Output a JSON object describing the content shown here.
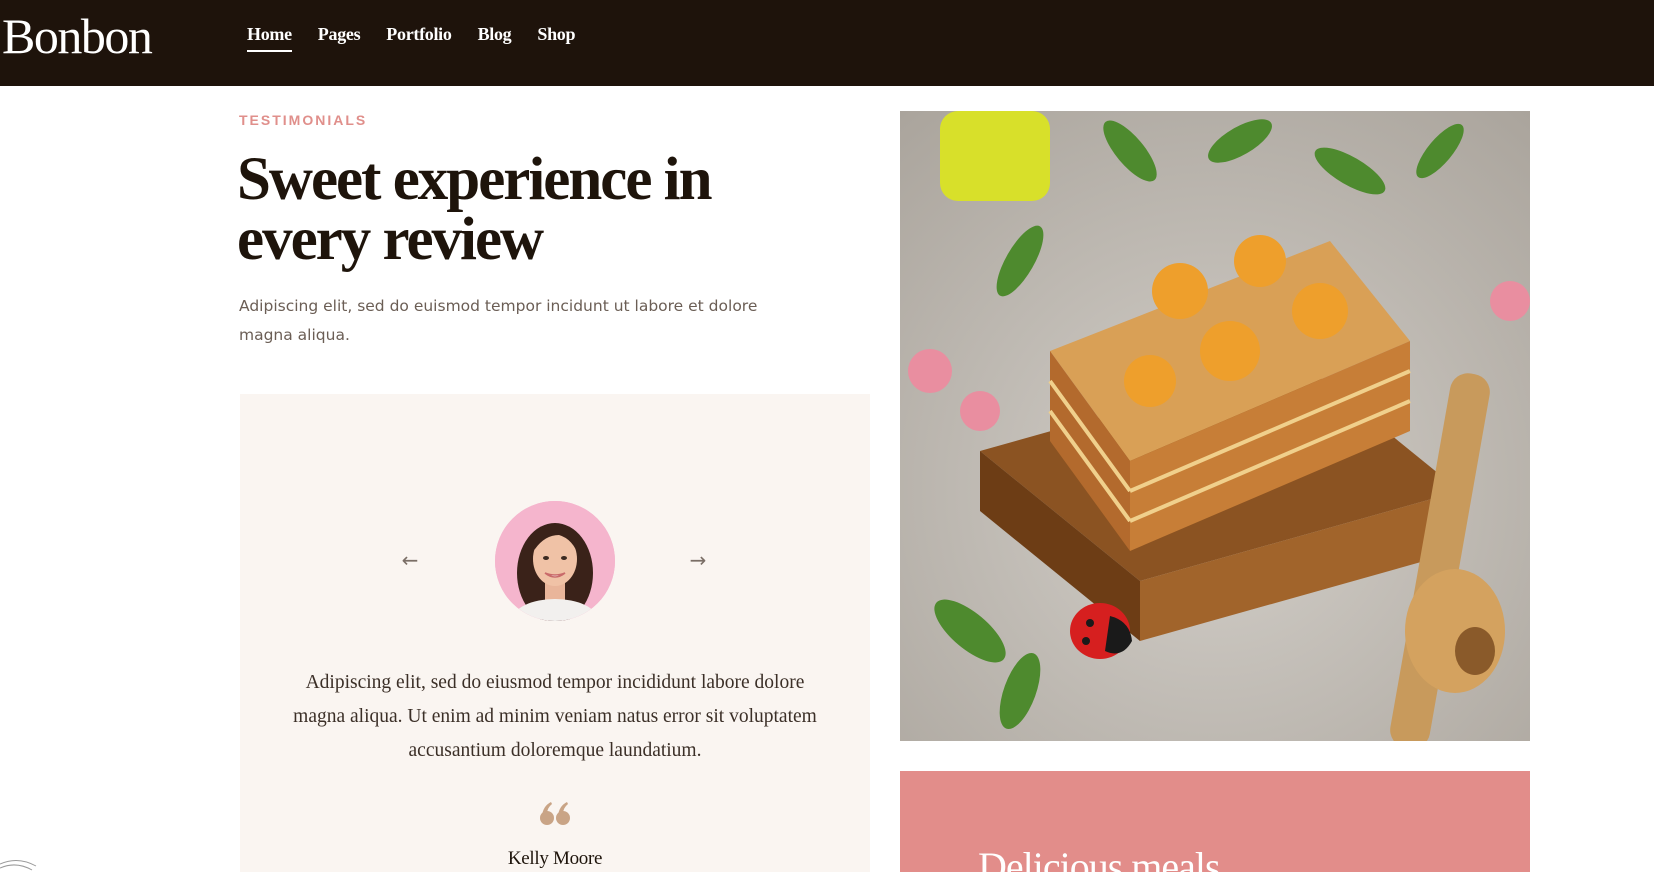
{
  "brand": {
    "logo_text": "Bonbon"
  },
  "nav": {
    "items": [
      {
        "label": "Home",
        "active": true
      },
      {
        "label": "Pages",
        "active": false
      },
      {
        "label": "Portfolio",
        "active": false
      },
      {
        "label": "Blog",
        "active": false
      },
      {
        "label": "Shop",
        "active": false
      }
    ]
  },
  "testimonials": {
    "eyebrow": "TESTIMONIALS",
    "heading_line1": "Sweet experience in",
    "heading_line2": "every review",
    "lead": "Adipiscing elit, sed do euismod tempor incidunt ut labore et dolore magna aliqua.",
    "prev_icon": "arrow-left-icon",
    "next_icon": "arrow-right-icon",
    "quote": "Adipiscing elit, sed do eiusmod tempor incididunt labore dolore magna aliqua. Ut enim ad minim veniam natus error sit voluptatem accusantium doloremque laundatium.",
    "author": "Kelly Moore"
  },
  "promo": {
    "title": "Delicious meals"
  },
  "colors": {
    "topbar_bg": "#1e130b",
    "accent_pink": "#e08f8b",
    "card_bg": "#faf5f1",
    "promo_bg": "#e28d8a",
    "quote_mark": "#c9a486"
  }
}
